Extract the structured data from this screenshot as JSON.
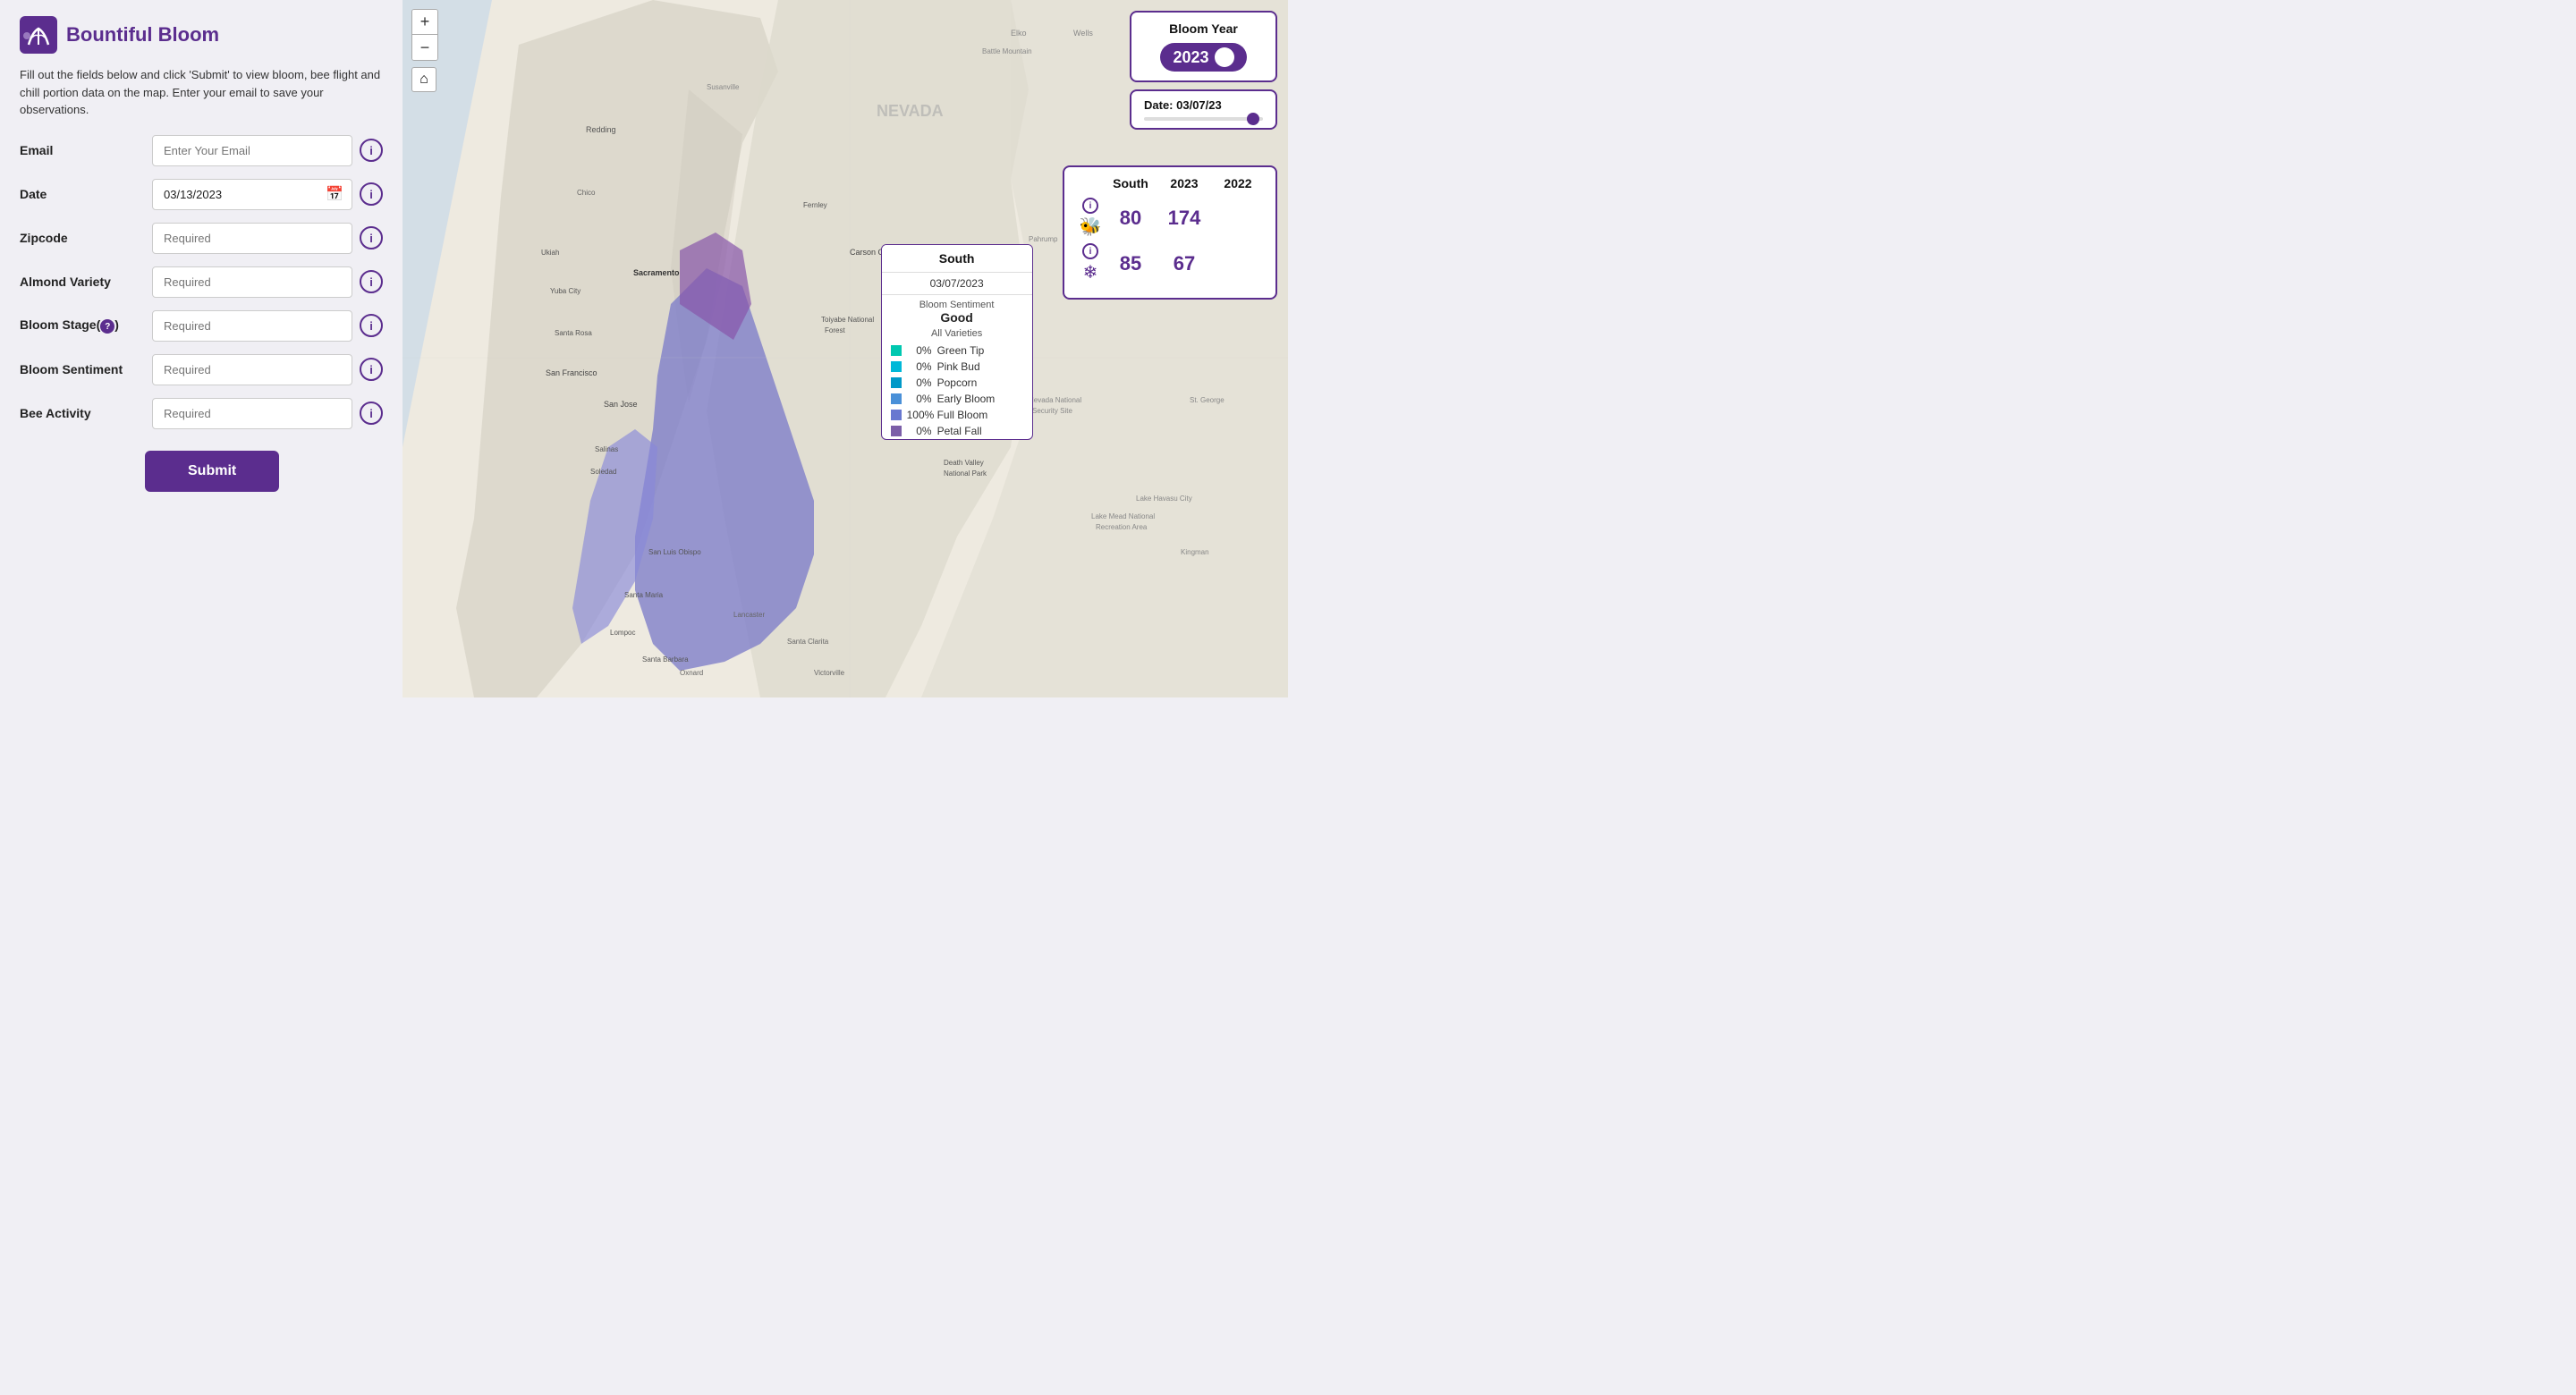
{
  "logo": {
    "text": "Bountiful Bloom"
  },
  "description": "Fill out the fields below and click 'Submit' to view bloom, bee flight and chill portion data on the map. Enter your email to save your observations.",
  "form": {
    "email_label": "Email",
    "email_placeholder": "Enter Your Email",
    "date_label": "Date",
    "date_value": "03/13/2023",
    "zipcode_label": "Zipcode",
    "zipcode_placeholder": "Required",
    "almond_label": "Almond Variety",
    "almond_placeholder": "Required",
    "bloom_stage_label": "Bloom Stage",
    "bloom_stage_q": "?",
    "bloom_stage_placeholder": "Required",
    "bloom_sentiment_label": "Bloom Sentiment",
    "bloom_sentiment_placeholder": "Required",
    "bee_activity_label": "Bee Activity",
    "bee_activity_placeholder": "Required",
    "submit_label": "Submit"
  },
  "map_controls": {
    "zoom_in": "+",
    "zoom_out": "−",
    "home": "⌂"
  },
  "bloom_year_card": {
    "title": "Bloom Year",
    "year": "2023"
  },
  "date_card": {
    "title": "Date: 03/07/23"
  },
  "stats_card": {
    "col1": "South",
    "col2": "2023",
    "col3": "2022",
    "bee_label": "🐝",
    "snow_label": "❄",
    "bee_2023": "80",
    "bee_2022": "174",
    "snow_2023": "85",
    "snow_2022": "67"
  },
  "popup": {
    "title": "South",
    "date": "03/07/2023",
    "sentiment_label": "Bloom Sentiment",
    "sentiment_value": "Good",
    "varieties": "All Varieties",
    "stages": [
      {
        "pct": "0%",
        "label": "Green Tip",
        "color": "#00c8b0"
      },
      {
        "pct": "0%",
        "label": "Pink Bud",
        "color": "#00b8d8"
      },
      {
        "pct": "0%",
        "label": "Popcorn",
        "color": "#0099c8"
      },
      {
        "pct": "0%",
        "label": "Early Bloom",
        "color": "#4a90d8"
      },
      {
        "pct": "100%",
        "label": "Full Bloom",
        "color": "#6878d0"
      },
      {
        "pct": "0%",
        "label": "Petal Fall",
        "color": "#7b5ea8"
      }
    ]
  }
}
